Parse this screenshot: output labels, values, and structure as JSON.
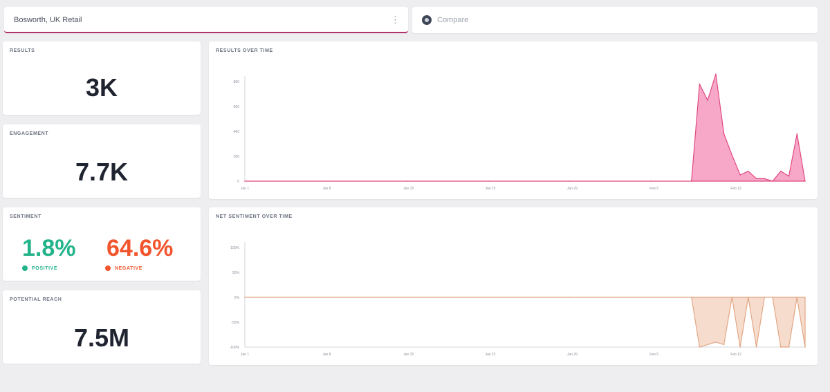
{
  "search": {
    "query": "Bosworth, UK Retail",
    "menu_icon": "kebab-menu-icon"
  },
  "compare": {
    "label": "Compare",
    "icon": "compare-icon"
  },
  "kpis": {
    "results": {
      "label": "RESULTS",
      "value": "3K"
    },
    "engagement": {
      "label": "ENGAGEMENT",
      "value": "7.7K"
    },
    "sentiment": {
      "label": "SENTIMENT",
      "positive_value": "1.8%",
      "negative_value": "64.6%",
      "positive_label": "POSITIVE",
      "negative_label": "NEGATIVE"
    },
    "reach": {
      "label": "POTENTIAL REACH",
      "value": "7.5M"
    }
  },
  "colors": {
    "accent": "#b3306a",
    "results_line": "#e0487f",
    "results_fill": "#f7a8c8",
    "sentiment_line": "#e2a785",
    "sentiment_fill": "#f6dccd",
    "positive": "#22b38a",
    "negative": "#f2542d"
  },
  "chart_data": [
    {
      "type": "area",
      "title": "RESULTS OVER TIME",
      "x_ticks": [
        "Jan 1",
        "Jan 8",
        "Jan 15",
        "Jan 22",
        "Jan 29",
        "Feb 5",
        "Feb 12"
      ],
      "y_ticks": [
        "800",
        "600",
        "400",
        "200",
        "0"
      ],
      "ylim": [
        0,
        800
      ],
      "x_index": [
        0,
        10,
        20,
        30,
        40,
        50,
        55,
        56,
        57,
        58,
        59,
        60,
        61,
        62,
        63,
        64,
        65,
        66,
        67,
        68,
        69
      ],
      "values": [
        0,
        0,
        0,
        0,
        0,
        0,
        0,
        780,
        650,
        860,
        380,
        210,
        50,
        80,
        20,
        20,
        0,
        80,
        40,
        380,
        0
      ]
    },
    {
      "type": "area",
      "title": "NET SENTIMENT OVER TIME",
      "x_ticks": [
        "Jan 1",
        "Jan 8",
        "Jan 15",
        "Jan 22",
        "Jan 29",
        "Feb 5",
        "Feb 12"
      ],
      "y_ticks": [
        "100%",
        "50%",
        "0%",
        "-50%",
        "-100%"
      ],
      "ylim": [
        -100,
        100
      ],
      "x_index": [
        0,
        10,
        20,
        30,
        40,
        50,
        55,
        56,
        57,
        58,
        59,
        60,
        61,
        62,
        63,
        64,
        65,
        66,
        67,
        68,
        69
      ],
      "values": [
        0,
        0,
        0,
        0,
        0,
        0,
        0,
        -100,
        -95,
        -90,
        -95,
        0,
        -100,
        0,
        -100,
        0,
        0,
        -100,
        -100,
        0,
        -100
      ]
    }
  ]
}
